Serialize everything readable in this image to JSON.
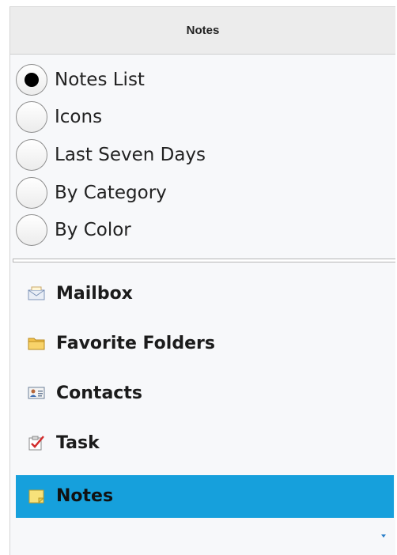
{
  "header": {
    "title": "Notes"
  },
  "views": [
    {
      "label": "Notes List",
      "selected": true
    },
    {
      "label": "Icons",
      "selected": false
    },
    {
      "label": "Last Seven Days",
      "selected": false
    },
    {
      "label": "By Category",
      "selected": false
    },
    {
      "label": "By Color",
      "selected": false
    }
  ],
  "nav": [
    {
      "label": "Mailbox",
      "icon": "mailbox-icon"
    },
    {
      "label": "Favorite Folders",
      "icon": "folder-icon"
    },
    {
      "label": "Contacts",
      "icon": "contact-card-icon"
    },
    {
      "label": "Task",
      "icon": "task-check-icon"
    },
    {
      "label": "Notes",
      "icon": "note-icon",
      "selected": true
    }
  ],
  "colors": {
    "selected_bg": "#16a0dc",
    "header_bg": "#ececec",
    "pane_bg": "#f7f8fa"
  }
}
